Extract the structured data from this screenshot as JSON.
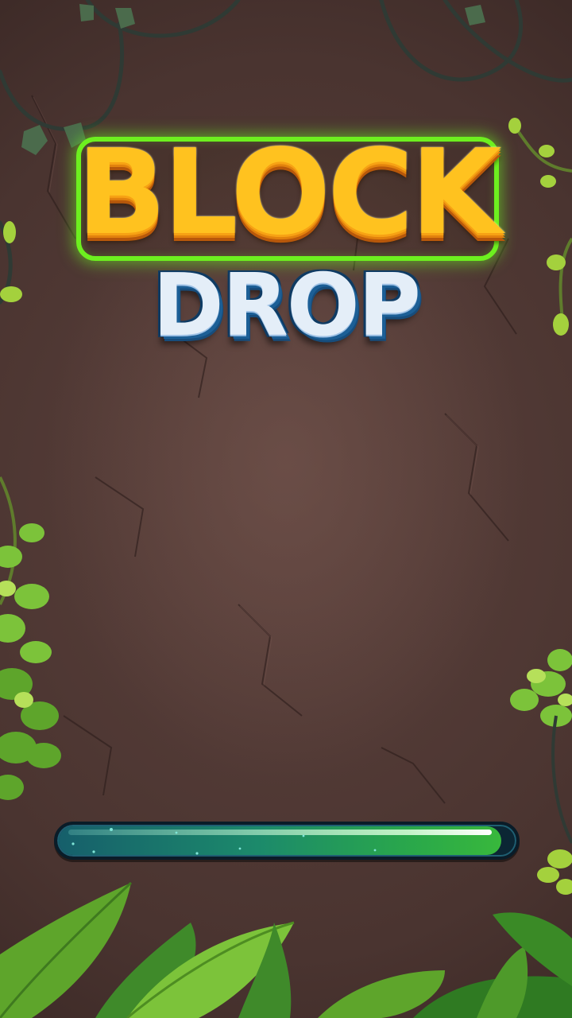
{
  "logo": {
    "line1": "BLOCK",
    "line2": "DROP",
    "colors": {
      "gold": "#ffc21f",
      "glow": "#6df01f",
      "drop_face": "#e4eef8",
      "drop_outline": "#0f3b63"
    }
  },
  "loading": {
    "progress": 0.97,
    "fill_color": "#38b83c",
    "track_color": "#0b2634"
  },
  "background": {
    "wall_color": "#4a3430",
    "leaf_color": "#7cc33a"
  }
}
